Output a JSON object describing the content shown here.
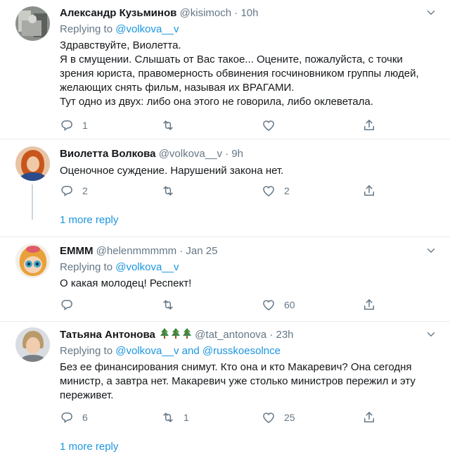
{
  "tweets": [
    {
      "name": "Александр Кузьминов",
      "handle": "@kisimoch",
      "time": "10h",
      "reply_prefix": "Replying to",
      "reply_to": "@volkova__v",
      "text": "Здравствуйте, Виолетта.\nЯ в смущении. Слышать от Вас такое... Оцените, пожалуйста, с точки зрения юриста, правомерность обвинения госчиновником группы людей, желающих снять фильм, называя их ВРАГАМИ.\nТут одно из двух: либо она этого не говорила, либо оклеветала.",
      "replies": "1",
      "retweets": "",
      "likes": ""
    },
    {
      "name": "Виолетта Волкова",
      "handle": "@volkova__v",
      "time": "9h",
      "text": "Оценочное суждение. Нарушений закона нет.",
      "replies": "2",
      "retweets": "",
      "likes": "2",
      "more_replies": "1 more reply"
    },
    {
      "name": "EMMM",
      "handle": "@helenmmmmm",
      "time": "Jan 25",
      "reply_prefix": "Replying to",
      "reply_to": "@volkova__v",
      "text": "О какая молодец! Респект!",
      "replies": "",
      "retweets": "",
      "likes": "60"
    },
    {
      "name": "Татьяна Антонова",
      "handle": "@tat_antonova",
      "time": "23h",
      "reply_prefix": "Replying to",
      "reply_to": "@volkova__v and @russkoesolnce",
      "text": "Без ее финансирования снимут. Кто она и кто Макаревич? Она сегодня министр, а завтра нет. Макаревич уже столько министров пережил и эту переживет.",
      "replies": "6",
      "retweets": "1",
      "likes": "25",
      "more_replies": "1 more reply"
    }
  ],
  "colors": {
    "accent": "#1b95e0",
    "muted": "#657786",
    "separator": "#e6ecf0"
  },
  "icons": [
    "reply-icon",
    "retweet-icon",
    "like-icon",
    "share-icon",
    "chevron-down-icon",
    "christmas-tree-icon"
  ]
}
